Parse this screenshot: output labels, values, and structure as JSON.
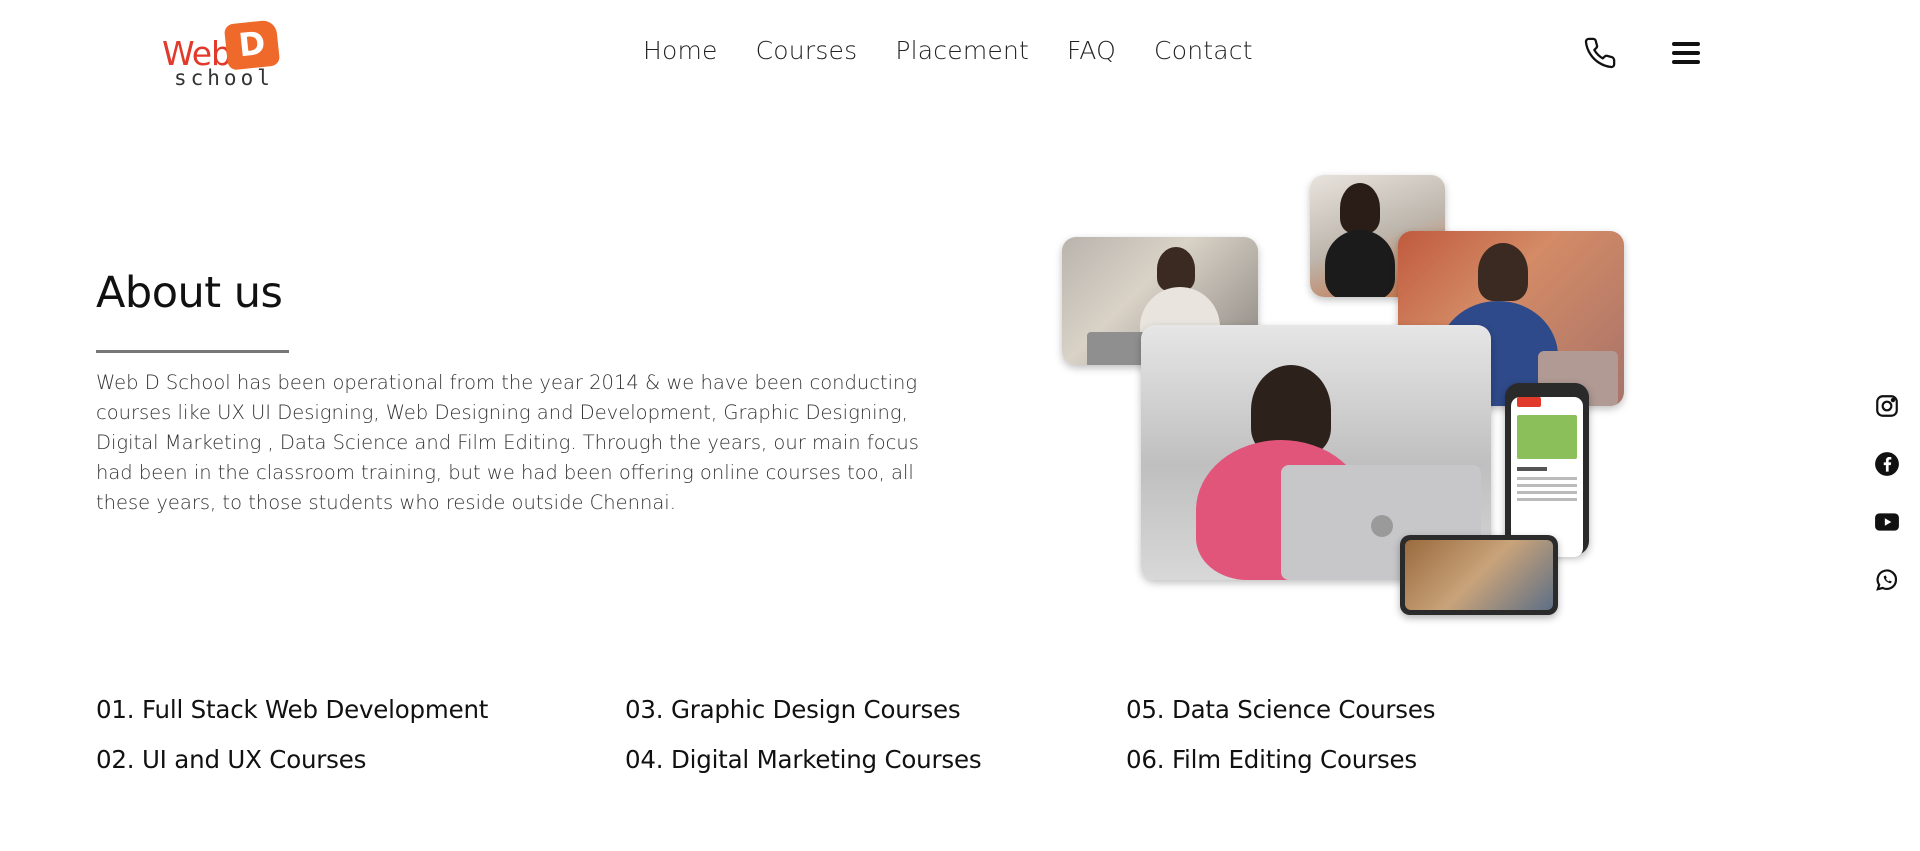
{
  "brand": {
    "logo_web": "Web",
    "logo_d": "D",
    "logo_school": "school"
  },
  "nav": {
    "items": [
      {
        "label": "Home"
      },
      {
        "label": "Courses"
      },
      {
        "label": "Placement"
      },
      {
        "label": "FAQ"
      },
      {
        "label": "Contact"
      }
    ],
    "phone_icon": "phone-icon",
    "menu_icon": "hamburger-menu-icon"
  },
  "about": {
    "title": "About us",
    "text": "Web D School has been operational from the year 2014 & we have been conducting courses like UX UI Designing, Web Designing and Development, Graphic Designing, Digital Marketing , Data Science and Film Editing. Through the years, our main focus had been in the classroom training, but we had been offering online courses too, all these years, to those students who reside outside Chennai."
  },
  "courses": [
    {
      "label": "01. Full Stack Web Development"
    },
    {
      "label": "02. UI and UX Courses"
    },
    {
      "label": "03. Graphic Design Courses"
    },
    {
      "label": "04. Digital Marketing Courses"
    },
    {
      "label": "05. Data Science Courses"
    },
    {
      "label": "06. Film Editing Courses"
    }
  ],
  "social": [
    "instagram-icon",
    "facebook-icon",
    "youtube-icon",
    "whatsapp-icon"
  ],
  "colors": {
    "logo_red": "#e23a2a",
    "logo_orange": "#ef6a2a",
    "text_dark": "#111111",
    "rule_gray": "#777777"
  }
}
